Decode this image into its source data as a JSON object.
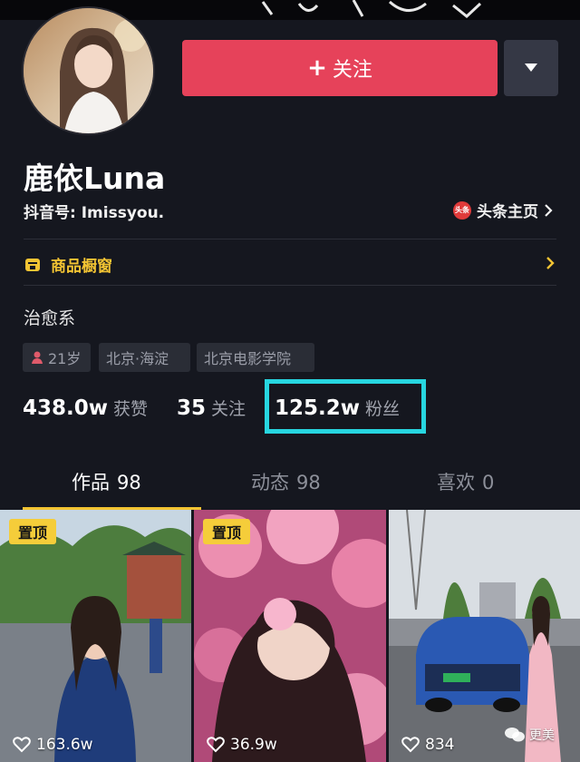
{
  "profile": {
    "name": "鹿依Luna",
    "douyin_id": "抖音号: Imissyou.",
    "toutiao_link": "头条主页",
    "toutiao_logo_text": "头条",
    "shop_label": "商品橱窗",
    "bio": "治愈系"
  },
  "actions": {
    "follow_label": "关注",
    "follow_plus": "+"
  },
  "tags": {
    "age": "21岁",
    "location": "北京·海淀",
    "school": "北京电影学院"
  },
  "stats": {
    "likes_num": "438.0w",
    "likes_label": "获赞",
    "following_num": "35",
    "following_label": "关注",
    "fans_num": "125.2w",
    "fans_label": "粉丝"
  },
  "tabs": [
    {
      "label": "作品",
      "count": "98"
    },
    {
      "label": "动态",
      "count": "98"
    },
    {
      "label": "喜欢",
      "count": "0"
    }
  ],
  "videos": [
    {
      "pinned": "置顶",
      "likes": "163.6w"
    },
    {
      "pinned": "置顶",
      "likes": "36.9w"
    },
    {
      "pinned": "",
      "likes": "834"
    }
  ],
  "watermark": "更美",
  "colors": {
    "accent_follow": "#e6425a",
    "accent_yellow": "#f3c433",
    "highlight_box": "#27d6e0",
    "background": "#15171f"
  },
  "icons": [
    "dropdown-triangle-icon",
    "toutiao-logo-icon",
    "shop-icon",
    "chevron-right-icon",
    "person-icon",
    "heart-icon",
    "wechat-icon"
  ]
}
